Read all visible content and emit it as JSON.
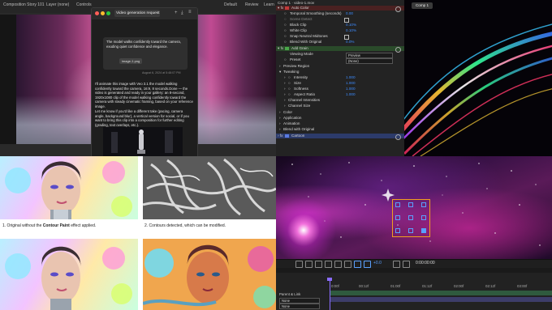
{
  "topbar": {
    "tabs": [
      "Composition Story 101",
      "Layer (none)",
      "Controls"
    ],
    "right_tabs": [
      "Default",
      "Review",
      "Learn"
    ]
  },
  "chat": {
    "title": "Video generation request",
    "attachment_label": "image-1.png",
    "user_message": "The model walks confidently toward the camera, exuding quiet confidence and elegance.",
    "timestamp": "August 6, 2024 at 5:48:07 PM",
    "reply_1": "I'll animate this image with Veo 3.1 the model walking confidently toward the camera, 16:9, 8 seconds.Done — the video is generated and ready in your gallery: an 8-second, 1920x1080 clip of the model walking confidently toward the camera with steady cinematic framing, based on your reference image.",
    "reply_2": "Let me know if you'd like a different take (pacing, camera angle, background blur), a vertical version for social, or if you want to bring this clip into a composition for further editing (grading, text overlays, etc.)."
  },
  "effects": {
    "header": "Comp 1 · video-1.mov",
    "rows": [
      {
        "label": "Auto Color",
        "kind": "red"
      },
      {
        "label": "Temporal Smoothing (seconds)",
        "value": "0.00"
      },
      {
        "label": "Scene Detect",
        "check": true
      },
      {
        "label": "Black Clip",
        "value": "0.10%"
      },
      {
        "label": "White Clip",
        "value": "0.10%"
      },
      {
        "label": "Snap Neutral Midtones",
        "check": true
      },
      {
        "label": "Blend With Original",
        "value": "0.0%"
      },
      {
        "label": "Add Grain",
        "kind": "green"
      },
      {
        "label": "Viewing Mode",
        "dropdown": "Preview"
      },
      {
        "label": "Preset",
        "dropdown": "(None)"
      },
      {
        "label": "Preview Region"
      },
      {
        "label": "Tweaking"
      },
      {
        "label": "Intensity",
        "value": "1.000"
      },
      {
        "label": "Size",
        "value": "1.000"
      },
      {
        "label": "Softness",
        "value": "1.000"
      },
      {
        "label": "Aspect Ratio",
        "value": "1.000"
      },
      {
        "label": "Channel Intensities"
      },
      {
        "label": "Channel Size"
      },
      {
        "label": "Color"
      },
      {
        "label": "Application"
      },
      {
        "label": "Animation"
      },
      {
        "label": "Blend with Original"
      },
      {
        "label": "Cartoon",
        "kind": "blue"
      }
    ]
  },
  "comp_tab": "Comp 1",
  "article": {
    "caption_1_pre": "1. Original without the ",
    "caption_1_bold": "Contour Paint",
    "caption_1_post": " effect applied.",
    "caption_2": "2. Contours detected, which can be modified."
  },
  "comp_toolbar": {
    "zoom": "+0.0",
    "timecode": "0:00:00:00"
  },
  "timeline": {
    "ticks": [
      "0:00f",
      "00:12f",
      "01:00f",
      "01:12f",
      "02:00f",
      "02:12f",
      "03:00f"
    ],
    "layer_label": "Parent & Link",
    "layer_values": [
      "None",
      "None"
    ]
  },
  "colors": {
    "accent_blue": "#3d8cff",
    "selection_orange": "#f0a020",
    "playhead_purple": "#8a6cff"
  }
}
